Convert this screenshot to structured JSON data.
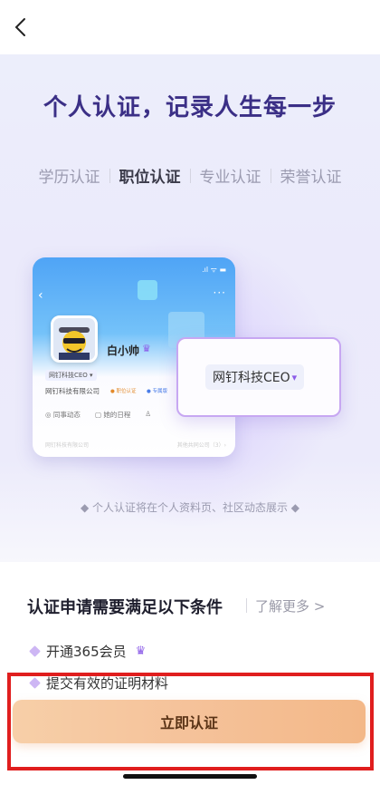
{
  "hero": {
    "title": "个人认证，记录人生每一步",
    "tabs": [
      "学历认证",
      "职位认证",
      "专业认证",
      "荣誉认证"
    ],
    "active_tab": "职位认证",
    "note": "◆ 个人认证将在个人资料页、社区动态展示 ◆"
  },
  "preview": {
    "user_name": "白小帅",
    "title_chip": "网钉科技CEO ▾",
    "company": "网钉科技有限公司",
    "tag1": "● 职位认证",
    "tag2": "● 专属版",
    "row_items": [
      "◎ 同事动态",
      "▢ 她的日程",
      "♙"
    ],
    "footer_left": "网钉科技有限公司",
    "footer_right": "其他共同公司（3）›",
    "status": ".ıl ᯤ ▬"
  },
  "popup": {
    "chip_text": "网钉科技CEO",
    "chip_icon": "▾"
  },
  "requirements": {
    "title": "认证申请需要满足以下条件",
    "more_link": "了解更多 >",
    "items": [
      "开通365会员",
      "提交有效的证明材料"
    ]
  },
  "action": {
    "primary_button": "立即认证"
  },
  "colors": {
    "title": "#3b2f86",
    "accent": "#8c5ce8",
    "highlight": "#e01e1e",
    "button_gradient_start": "#f7cfa8",
    "button_gradient_end": "#f3b888"
  }
}
